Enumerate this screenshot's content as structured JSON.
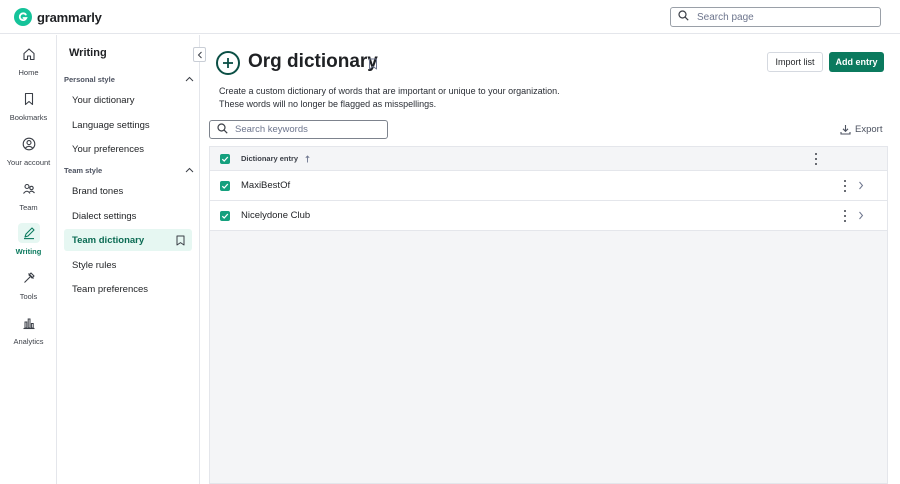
{
  "app": {
    "brand": "grammarly"
  },
  "search_page": {
    "placeholder": "Search page"
  },
  "rail": [
    {
      "label": "Home",
      "icon": "home-icon"
    },
    {
      "label": "Bookmarks",
      "icon": "bookmark-icon"
    },
    {
      "label": "Your account",
      "icon": "account-icon"
    },
    {
      "label": "Team",
      "icon": "team-icon"
    },
    {
      "label": "Writing",
      "icon": "pen-icon",
      "active": true
    },
    {
      "label": "Tools",
      "icon": "tools-icon"
    },
    {
      "label": "Analytics",
      "icon": "analytics-icon"
    }
  ],
  "sidebar": {
    "title": "Writing",
    "personal_section": "Personal style",
    "personal_items": [
      "Your dictionary",
      "Language settings",
      "Your preferences"
    ],
    "team_section": "Team style",
    "team_items": [
      "Brand tones",
      "Dialect settings",
      "Team dictionary",
      "Style rules",
      "Team preferences"
    ],
    "active_item": "Team dictionary"
  },
  "main": {
    "title": "Org dictionary",
    "import_label": "Import list",
    "add_label": "Add entry",
    "description_line1": "Create a custom dictionary of words that are important or unique to your organization.",
    "description_line2": "These words will no longer be flagged as misspellings.",
    "keyword_placeholder": "Search keywords",
    "export_label": "Export"
  },
  "table": {
    "header": "Dictionary entry",
    "sort": "ascending",
    "rows": [
      {
        "entry": "MaxiBestOf",
        "checked": true
      },
      {
        "entry": "Nicelydone Club",
        "checked": true
      }
    ]
  },
  "colors": {
    "accent": "#15c39a",
    "primary_button": "#0b7a5e",
    "active_bg": "#e6f7f2"
  }
}
